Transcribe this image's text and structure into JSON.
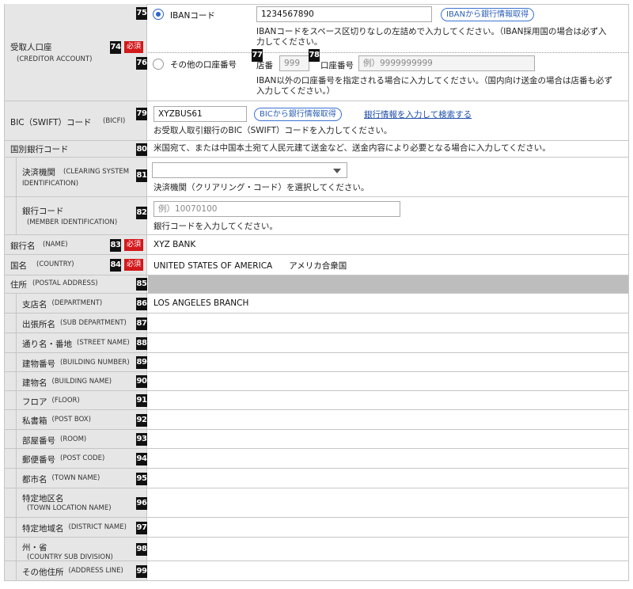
{
  "required_label": "必須",
  "creditor_account": {
    "number": "74",
    "label": "受取人口座",
    "label_en": "(CREDITOR ACCOUNT)",
    "iban": {
      "number": "75",
      "radio_label": "IBANコード",
      "value": "1234567890",
      "button": "IBANから銀行情報取得",
      "hint": "IBANコードをスペース区切りなしの左詰めで入力してください。（IBAN採用国の場合は必ず入力してください。"
    },
    "other": {
      "number": "76",
      "radio_label": "その他の口座番号",
      "branch_number": "77",
      "branch_label": "店番",
      "branch_value": "999",
      "account_number": "78",
      "account_label": "口座番号",
      "account_placeholder": "例）9999999999",
      "hint": "IBAN以外の口座番号を指定される場合に入力してください。（国内向け送金の場合は店番も必ず入力してください。）"
    }
  },
  "bic": {
    "number": "79",
    "label": "BIC（SWIFT）コード",
    "label_en": "(BICFI)",
    "value": "XYZBUS61",
    "button": "BICから銀行情報取得",
    "link": "銀行情報を入力して検索する",
    "hint": "お受取人取引銀行のBIC（SWIFT）コードを入力してください。"
  },
  "country_bank_code": {
    "number": "80",
    "label": "国別銀行コード",
    "hint": "米国宛て、または中国本土宛て人民元建て送金など、送金内容により必要となる場合に入力してください。",
    "clearing": {
      "number": "81",
      "label": "決済機関",
      "label_en1": "(CLEARING SYSTEM",
      "label_en2": "IDENTIFICATION)",
      "hint": "決済機関（クリアリング・コード）を選択してください。"
    },
    "member": {
      "number": "82",
      "label": "銀行コード",
      "label_en": "(MEMBER IDENTIFICATION)",
      "placeholder": "例）10070100",
      "hint": "銀行コードを入力してください。"
    }
  },
  "bank_name": {
    "number": "83",
    "label": "銀行名",
    "label_en": "(NAME)",
    "value": "XYZ BANK"
  },
  "country": {
    "number": "84",
    "label": "国名",
    "label_en": "(COUNTRY)",
    "value": "UNITED STATES OF AMERICA　　アメリカ合衆国"
  },
  "postal_address": {
    "number": "85",
    "label": "住所",
    "label_en": "(POSTAL ADDRESS)"
  },
  "address_rows": [
    {
      "number": "86",
      "label": "支店名",
      "label_en": "(DEPARTMENT)",
      "value": "LOS ANGELES BRANCH"
    },
    {
      "number": "87",
      "label": "出張所名",
      "label_en": "(SUB DEPARTMENT)",
      "value": ""
    },
    {
      "number": "88",
      "label": "通り名・番地",
      "label_en": "(STREET NAME)",
      "value": ""
    },
    {
      "number": "89",
      "label": "建物番号",
      "label_en": "(BUILDING NUMBER)",
      "value": ""
    },
    {
      "number": "90",
      "label": "建物名",
      "label_en": "(BUILDING NAME)",
      "value": ""
    },
    {
      "number": "91",
      "label": "フロア",
      "label_en": "(FLOOR)",
      "value": ""
    },
    {
      "number": "92",
      "label": "私書箱",
      "label_en": "(POST BOX)",
      "value": ""
    },
    {
      "number": "93",
      "label": "部屋番号",
      "label_en": "(ROOM)",
      "value": ""
    },
    {
      "number": "94",
      "label": "郵便番号",
      "label_en": "(POST CODE)",
      "value": ""
    },
    {
      "number": "95",
      "label": "都市名",
      "label_en": "(TOWN NAME)",
      "value": ""
    },
    {
      "number": "96",
      "label": "特定地区名",
      "label_en": "(TOWN LOCATION NAME)",
      "value": ""
    },
    {
      "number": "97",
      "label": "特定地域名",
      "label_en": "(DISTRICT NAME)",
      "value": ""
    },
    {
      "number": "98",
      "label": "州・省",
      "label_en": "(COUNTRY SUB DIVISION)",
      "value": ""
    },
    {
      "number": "99",
      "label": "その他住所",
      "label_en": "(ADDRESS LINE)",
      "value": ""
    }
  ]
}
